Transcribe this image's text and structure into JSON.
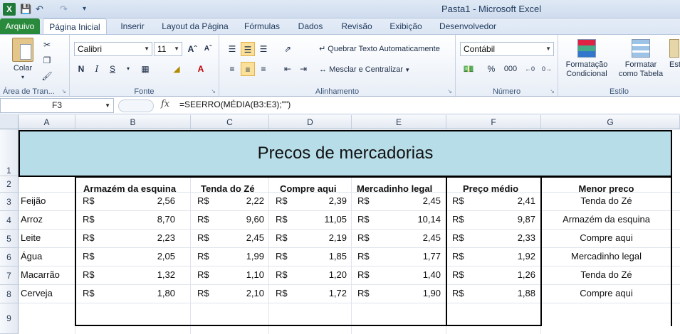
{
  "window": {
    "title": "Pasta1 - Microsoft Excel"
  },
  "tabs": {
    "file": "Arquivo",
    "items": [
      "Página Inicial",
      "Inserir",
      "Layout da Página",
      "Fórmulas",
      "Dados",
      "Revisão",
      "Exibição",
      "Desenvolvedor"
    ],
    "active": "Página Inicial"
  },
  "ribbon": {
    "clipboard": {
      "paste": "Colar",
      "label": "Área de Tran..."
    },
    "font": {
      "name": "Calibri",
      "size": "11",
      "bold": "N",
      "italic": "I",
      "underline": "S",
      "label": "Fonte"
    },
    "alignment": {
      "wrap": "Quebrar Texto Automaticamente",
      "merge": "Mesclar e Centralizar",
      "label": "Alinhamento"
    },
    "number": {
      "format": "Contábil",
      "percent": "%",
      "thousands": "000",
      "label": "Número"
    },
    "styles": {
      "conditional_line1": "Formatação",
      "conditional_line2": "Condicional",
      "table_line1": "Formatar",
      "table_line2": "como Tabela",
      "cell_styles": "Est",
      "label": "Estilo"
    }
  },
  "formula_bar": {
    "name_box": "F3",
    "fx": "fx",
    "formula": "=SEERRO(MÉDIA(B3:E3);\"\")"
  },
  "columns": [
    "A",
    "B",
    "C",
    "D",
    "E",
    "F",
    "G"
  ],
  "rows": [
    "1",
    "2",
    "3",
    "4",
    "5",
    "6",
    "7",
    "8",
    "9"
  ],
  "sheet": {
    "title": "Precos de mercadorias",
    "headers": [
      "Armazém da esquina",
      "Tenda do Zé",
      "Compre aqui",
      "Mercadinho legal",
      "Preço médio",
      "Menor preco"
    ],
    "currency": "R$",
    "products": [
      {
        "name": "Feijão",
        "values": [
          "2,56",
          "2,22",
          "2,39",
          "2,45"
        ],
        "avg": "2,41",
        "lowest": "Tenda do Zé"
      },
      {
        "name": "Arroz",
        "values": [
          "8,70",
          "9,60",
          "11,05",
          "10,14"
        ],
        "avg": "9,87",
        "lowest": "Armazém da esquina"
      },
      {
        "name": "Leite",
        "values": [
          "2,23",
          "2,45",
          "2,19",
          "2,45"
        ],
        "avg": "2,33",
        "lowest": "Compre aqui"
      },
      {
        "name": "Água",
        "values": [
          "2,05",
          "1,99",
          "1,85",
          "1,77"
        ],
        "avg": "1,92",
        "lowest": "Mercadinho legal"
      },
      {
        "name": "Macarrão",
        "values": [
          "1,32",
          "1,10",
          "1,20",
          "1,40"
        ],
        "avg": "1,26",
        "lowest": "Tenda do Zé"
      },
      {
        "name": "Cerveja",
        "values": [
          "1,80",
          "2,10",
          "1,72",
          "1,90"
        ],
        "avg": "1,88",
        "lowest": "Compre aqui"
      }
    ]
  }
}
